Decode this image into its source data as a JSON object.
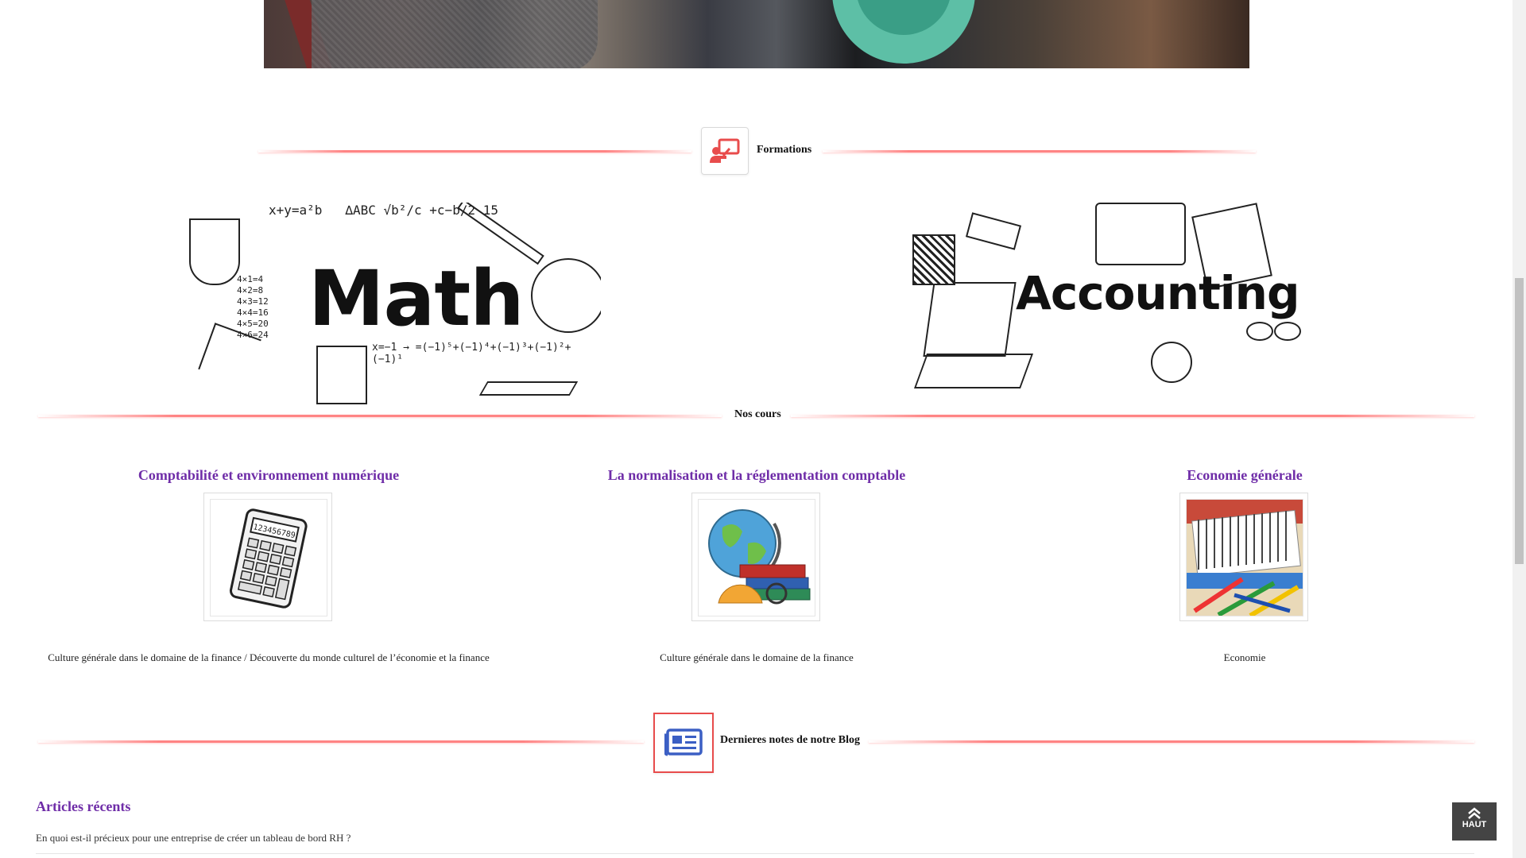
{
  "sections": {
    "formations": {
      "label": "Formations",
      "icon": "teacher-board-icon"
    },
    "courses": {
      "label": "Nos cours"
    },
    "blog": {
      "label": "Dernieres notes de notre Blog",
      "icon": "newspaper-icon"
    }
  },
  "banners": [
    {
      "text": "Math",
      "alt": "math-doodle-banner"
    },
    {
      "text": "Accounting",
      "alt": "accounting-doodle-banner"
    }
  ],
  "courses": [
    {
      "title": "Comptabilité et environnement numérique",
      "image": "calculator-image",
      "description": "Culture générale dans le domaine de la finance / Découverte du monde culturel de l’économie et la finance"
    },
    {
      "title": "La normalisation et la réglementation comptable",
      "image": "globe-books-image",
      "description": "Culture générale dans le domaine de la finance"
    },
    {
      "title": "Economie générale",
      "image": "notebooks-pens-image",
      "description": "Economie"
    }
  ],
  "blog": {
    "articles_title": "Articles récents",
    "articles": [
      "En quoi est-il précieux pour une entreprise de créer un tableau de bord RH ?"
    ]
  },
  "back_to_top": {
    "label": "HAUT",
    "icon": "double-chevron-up-icon"
  },
  "colors": {
    "accent_purple": "#6f2da8",
    "rule_red": "#ff6e6e",
    "icon_red": "#e84c4c",
    "icon_blue": "#3b5fc4"
  }
}
